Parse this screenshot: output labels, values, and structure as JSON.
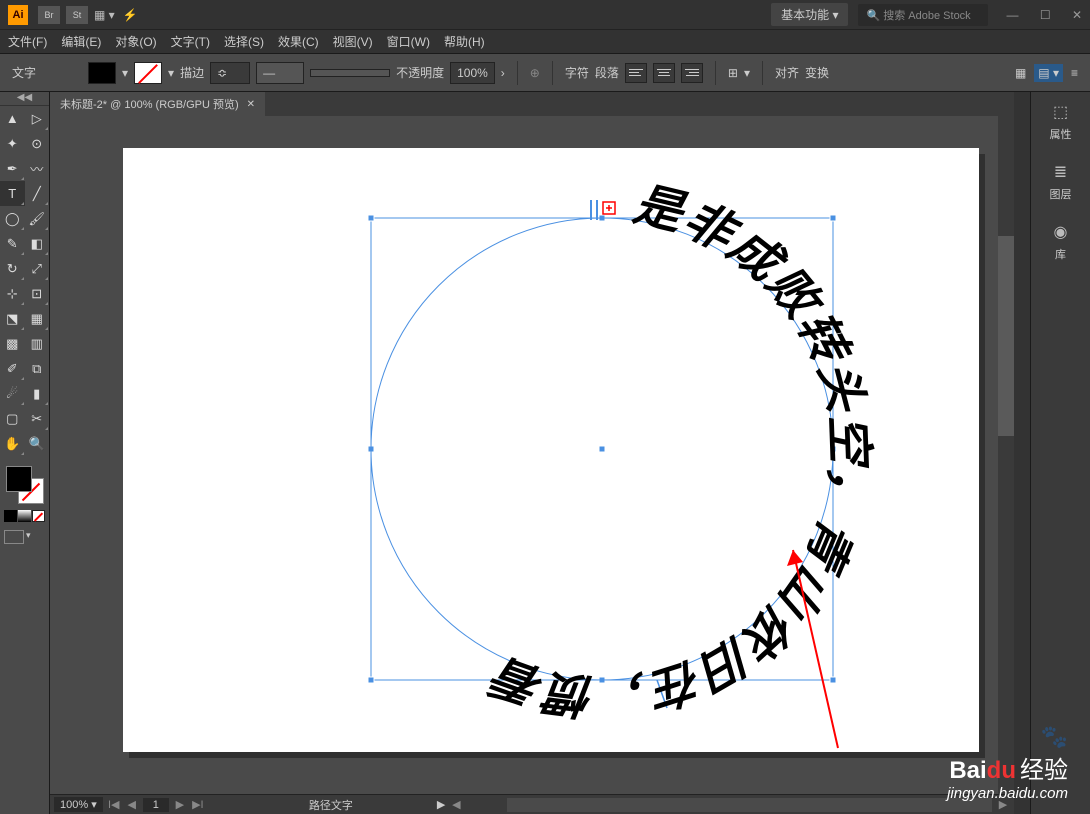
{
  "app": {
    "name": "Ai"
  },
  "titlebar": {
    "bridge": "Br",
    "stock": "St",
    "workspace": "基本功能",
    "search_placeholder": "搜索 Adobe Stock"
  },
  "menu": {
    "file": "文件(F)",
    "edit": "编辑(E)",
    "object": "对象(O)",
    "type": "文字(T)",
    "select": "选择(S)",
    "effect": "效果(C)",
    "view": "视图(V)",
    "window": "窗口(W)",
    "help": "帮助(H)"
  },
  "controlbar": {
    "context": "文字",
    "stroke_label": "描边",
    "stroke_weight": "",
    "opacity_label": "不透明度",
    "opacity_value": "100%",
    "char_label": "字符",
    "para_label": "段落",
    "align_label": "对齐",
    "transform_label": "变换"
  },
  "document": {
    "tab_title": "未标题-2* @ 100% (RGB/GPU 预览)",
    "canvas_text": "是非成败转头空，青山依旧在，惯看"
  },
  "statusbar": {
    "zoom": "100%",
    "page": "1",
    "mode": "路径文字"
  },
  "panels": {
    "properties": "属性",
    "layers": "图层",
    "libraries": "库"
  },
  "watermark": {
    "brand_bai": "Bai",
    "brand_du": "du",
    "brand_jy": "经验",
    "url": "jingyan.baidu.com"
  }
}
